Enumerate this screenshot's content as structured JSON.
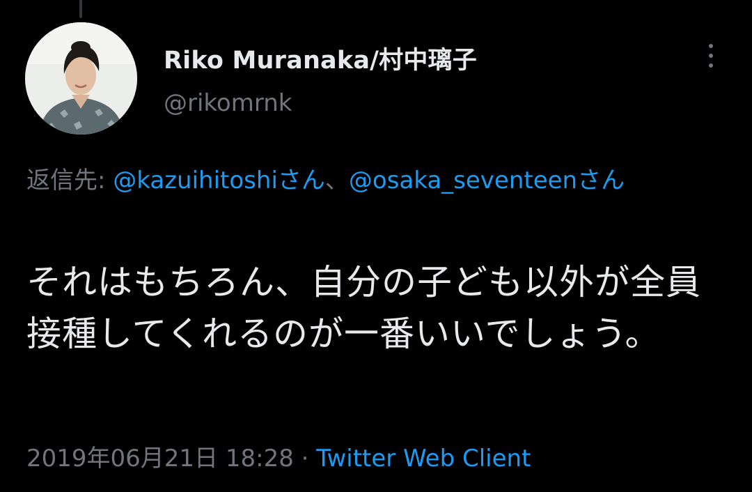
{
  "tweet": {
    "author": {
      "display_name": "Riko Muranaka/村中璃子",
      "handle": "@rikomrnk",
      "avatar_icon": "profile-photo"
    },
    "more_icon": "more-vertical-icon",
    "reply": {
      "prefix": "返信先:",
      "mentions": [
        "@kazuihitoshi",
        "@osaka_seventeen"
      ],
      "honorific": "さん",
      "separator": "、"
    },
    "text": "それはもちろん、自分の子ども以外が全員接種してくれるのが一番いいでしょう。",
    "timestamp": "2019年06月21日 18:28",
    "dot_separator": "·",
    "source": "Twitter Web Client"
  },
  "colors": {
    "background": "#000000",
    "primary_text": "#e7e9ea",
    "secondary_text": "#71767b",
    "link": "#1d9bf0"
  }
}
